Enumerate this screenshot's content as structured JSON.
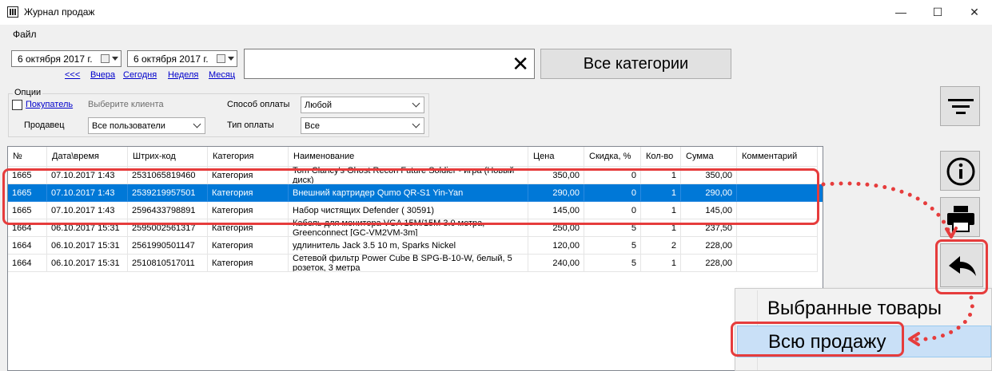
{
  "window": {
    "title": "Журнал продаж",
    "min_glyph": "—",
    "max_glyph": "☐",
    "close_glyph": "✕"
  },
  "menu": {
    "file": "Файл"
  },
  "date_from": "6  октября  2017 г.",
  "date_to": "6  октября  2017 г.",
  "quick_links": [
    "<<<",
    "Вчера",
    "Сегодня",
    "Неделя",
    "Месяц"
  ],
  "search": {
    "value": "",
    "clear_glyph": "✕"
  },
  "category_button": "Все категории",
  "options": {
    "legend": "Опции",
    "buyer_label": "Покупатель",
    "buyer_checked": false,
    "buyer_value": "Выберите клиента",
    "seller_label": "Продавец",
    "seller_value": "Все пользователи",
    "payment_method_label": "Способ оплаты",
    "payment_method_value": "Любой",
    "payment_type_label": "Тип оплаты",
    "payment_type_value": "Все"
  },
  "table": {
    "columns": [
      "№",
      "Дата\\время",
      "Штрих-код",
      "Категория",
      "Наименование",
      "Цена",
      "Скидка, %",
      "Кол-во",
      "Сумма",
      "Комментарий"
    ],
    "rows": [
      [
        "1665",
        "07.10.2017 1:43",
        "2531065819460",
        "Категория",
        "Tom Clancy's Ghost Recon Future Soldier - игра (Новый диск)",
        "350,00",
        "0",
        "1",
        "350,00",
        ""
      ],
      [
        "1665",
        "07.10.2017 1:43",
        "2539219957501",
        "Категория",
        "Внешний картридер Qumo QR-S1 Yin-Yan",
        "290,00",
        "0",
        "1",
        "290,00",
        ""
      ],
      [
        "1665",
        "07.10.2017 1:43",
        "2596433798891",
        "Категория",
        "Набор чистящих Defender ( 30591)",
        "145,00",
        "0",
        "1",
        "145,00",
        ""
      ],
      [
        "1664",
        "06.10.2017 15:31",
        "2595002561317",
        "Категория",
        "Кабель для монитора VGA 15M/15M 3.0 метра, Greenconnect [GC-VM2VM-3m]",
        "250,00",
        "5",
        "1",
        "237,50",
        ""
      ],
      [
        "1664",
        "06.10.2017 15:31",
        "2561990501147",
        "Категория",
        "удлинитель Jack 3.5 10 m, Sparks Nickel",
        "120,00",
        "5",
        "2",
        "228,00",
        ""
      ],
      [
        "1664",
        "06.10.2017 15:31",
        "2510810517011",
        "Категория",
        "Сетевой фильтр Power Cube B SPG-B-10-W, белый, 5 розеток, 3 метра",
        "240,00",
        "5",
        "1",
        "228,00",
        ""
      ]
    ],
    "selected_row": 1
  },
  "context_menu": {
    "items": [
      "Выбранные товары",
      "Всю продажу"
    ],
    "highlighted": 1
  },
  "colors": {
    "selection": "#0078d7",
    "annotation": "#e63c3c",
    "link": "#0000cc"
  },
  "icons": [
    "filter-icon",
    "info-icon",
    "printer-icon",
    "return-arrow-icon"
  ]
}
